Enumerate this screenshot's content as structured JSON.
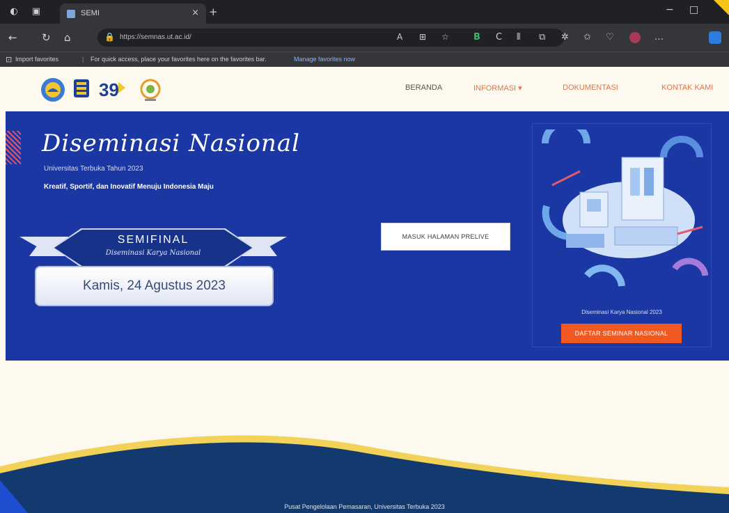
{
  "browser": {
    "tab_title": "SEMI",
    "tab_close": "×",
    "new_tab": "+",
    "window_min": "−",
    "window_max": "□",
    "url": "https://semnas.ut.ac.id/",
    "favbar_import": "Import favorites",
    "favbar_hint": "For quick access, place your favorites here on the favorites bar.",
    "favbar_link": "Manage favorites now"
  },
  "site": {
    "nav": [
      {
        "label": "BERANDA"
      },
      {
        "label": "INFORMASI ▾"
      },
      {
        "label": "DOKUMENTASI"
      },
      {
        "label": "KONTAK KAMI"
      }
    ]
  },
  "hero": {
    "title": "Diseminasi Nasional",
    "subtitle": "Universitas Terbuka Tahun 2023",
    "tagline": "Kreatif, Sportif, dan Inovatif Menuju Indonesia Maju",
    "ribbon_main": "SEMIFINAL",
    "ribbon_script": "Diseminasi Karya Nasional",
    "date": "Kamis, 24 Agustus 2023",
    "cta_white": "MASUK HALAMAN PRELIVE",
    "card_caption": "Diseminasi Karya Nasional 2023",
    "cta_orange": "DAFTAR SEMINAR NASIONAL"
  },
  "footer": {
    "text": "Pusat Pengelolaan Pemasaran, Universitas Terbuka 2023"
  },
  "colors": {
    "hero_bg": "#1b37a4",
    "accent_orange": "#f05a22",
    "nav_active": "#e2734b",
    "page_bg": "#fdf9ee"
  }
}
